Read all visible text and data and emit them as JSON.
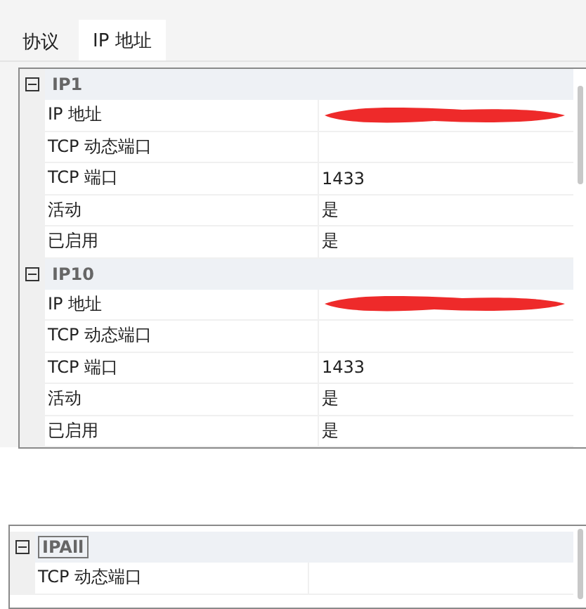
{
  "tabs": [
    {
      "label": "协议",
      "selected": false
    },
    {
      "label": "IP 地址",
      "selected": true
    }
  ],
  "property_grid": {
    "groups": [
      {
        "title": "IP1",
        "expanded": true,
        "focused": false,
        "rows": [
          {
            "name": "IP 地址",
            "redacted": true
          },
          {
            "name": "TCP 动态端口"
          },
          {
            "name": "TCP 端口",
            "value": "1433"
          },
          {
            "name": "活动",
            "value": "是"
          },
          {
            "name": "已启用",
            "value": "是"
          }
        ]
      },
      {
        "title": "IP10",
        "expanded": true,
        "focused": false,
        "rows": [
          {
            "name": "IP 地址",
            "redacted": true
          },
          {
            "name": "TCP 动态端口"
          },
          {
            "name": "TCP 端口",
            "value": "1433"
          },
          {
            "name": "活动",
            "value": "是"
          },
          {
            "name": "已启用",
            "value": "是"
          }
        ]
      }
    ]
  },
  "second_grid": {
    "groups": [
      {
        "title": "IPAll",
        "expanded": true,
        "focused": true,
        "rows": [
          {
            "name": "TCP 动态端口"
          }
        ]
      }
    ]
  }
}
